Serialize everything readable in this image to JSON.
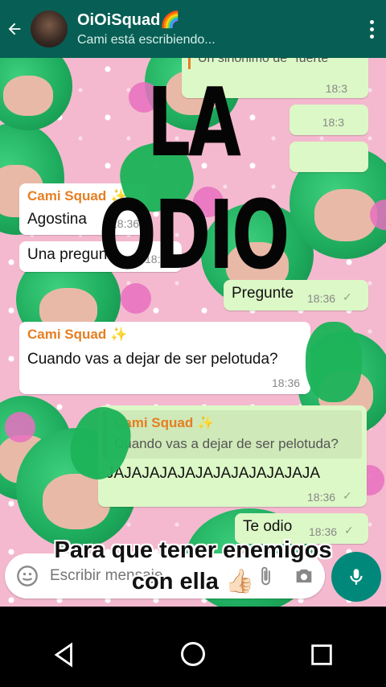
{
  "header": {
    "title": "OiOiSquad🌈",
    "status": "Cami está escribiendo..."
  },
  "overlay": {
    "big_text": "LA ODIO",
    "caption_line1": "Para que tener enemigos",
    "caption_line2": "con ella 👍🏻"
  },
  "top_hidden": {
    "quoted_fragment": "Un sinonimo de \"fuerte\"",
    "time": "18:3"
  },
  "messages": {
    "m1": {
      "sender": "Cami Squad ✨",
      "text": "Agostina",
      "time": "18:36"
    },
    "m2": {
      "text": "Una pregunta",
      "time": "18:36"
    },
    "m3": {
      "text": "Pregunte",
      "time": "18:36"
    },
    "m4": {
      "sender": "Cami Squad ✨",
      "text": "Cuando vas a dejar de ser pelotuda?",
      "time": "18:36"
    },
    "m5": {
      "quote_sender": "Cami Squad ✨",
      "quote_text": "Cuando vas a dejar de ser pelotuda?",
      "text": "JAJAJAJAJAJAJAJAJAJAJAJA",
      "time": "18:36"
    },
    "m6": {
      "text": "Te odio",
      "time": "18:36"
    }
  },
  "input": {
    "placeholder": "Escribir mensaje"
  },
  "icons": {
    "back": "arrow-left-icon",
    "menu": "more-vert-icon",
    "emoji": "emoji-icon",
    "attach": "paperclip-icon",
    "camera": "camera-icon",
    "mic": "mic-icon"
  },
  "colors": {
    "header": "#075e54",
    "outgoing": "#dcf8c6",
    "incoming": "#ffffff",
    "sender": "#e67e22",
    "mic": "#00897b"
  }
}
